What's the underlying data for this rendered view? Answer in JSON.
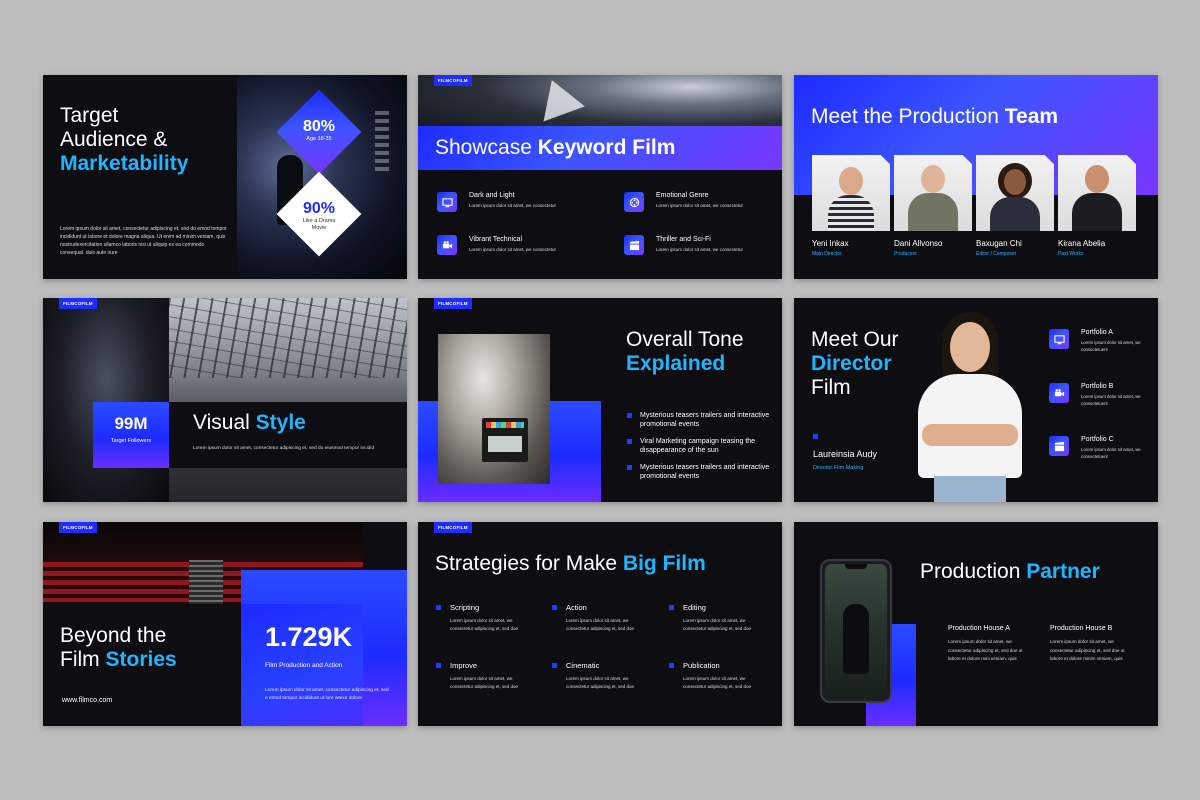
{
  "brand_tag": "FILMCOFILM",
  "s1": {
    "title_line1": "Target",
    "title_line2": "Audience &",
    "title_line3": "Marketability",
    "body": "Lorem ipsum dolor sit amet, consectetur adipiscing et, sed do emod tempor incididunt ut labore et dolore magna aliqua. Ut enim ad minim veniam, quis nostrudexercitation ullamco laboris nisi ut aliquip ex ea commodo consequat. duis aute irure",
    "stat1_value": "80%",
    "stat1_label": "Age 18-35",
    "stat2_value": "90%",
    "stat2_label": "Like a Drama Movie"
  },
  "s2": {
    "title_a": "Showcase ",
    "title_b": "Keyword Film",
    "items": [
      {
        "title": "Dark and Light",
        "desc": "Lorem ipsum dolor sit amet, we consectetur",
        "icon": "monitor-icon"
      },
      {
        "title": "Emotional Genre",
        "desc": "Lorem ipsum dolor sit amet, we consectetur",
        "icon": "film-reel-icon"
      },
      {
        "title": "Vibrant Technical",
        "desc": "Lorem ipsum dolor sit amet, we consectetur",
        "icon": "video-camera-icon"
      },
      {
        "title": "Thriller and Sci-Fi",
        "desc": "Lorem ipsum dolor sit amet, we consectetur",
        "icon": "clapperboard-icon"
      }
    ]
  },
  "s3": {
    "title_a": "Meet the Production ",
    "title_b": "Team",
    "members": [
      {
        "name": "Yeni Inkax",
        "role": "Main Director"
      },
      {
        "name": "Dani Allvonso",
        "role": "Producers"
      },
      {
        "name": "Baxugan Chi",
        "role": "Editor / Composer"
      },
      {
        "name": "Kirana Abelia",
        "role": "Past Works"
      }
    ]
  },
  "s4": {
    "stat_value": "99M",
    "stat_label": "Target Followers",
    "title_a": "Visual ",
    "title_b": "Style",
    "body": "Lorem ipsum dolor sit amet, consectetur adipiscing et, sed do eiusmod tempor incidid"
  },
  "s5": {
    "title_line1": "Overall Tone",
    "title_line2": "Explained",
    "bullets": [
      "Mysterious teasers trailers and interactive promotional events",
      "Viral Marketing campaign teasing the disappearance of the sun",
      "Mysterious teasers trailers and interactive promotional events"
    ]
  },
  "s6": {
    "title_line1": "Meet Our",
    "title_line2": "Director",
    "title_line3": "Film",
    "name": "Laureinsia Audy",
    "role": "Director Film Making",
    "portfolios": [
      {
        "title": "Portfolio A",
        "desc": "Lorem ipsum dolor sit amet, we consectetuerir",
        "icon": "monitor-icon"
      },
      {
        "title": "Portfolio B",
        "desc": "Lorem ipsum dolor sit amet, we consectetuerir",
        "icon": "video-camera-icon"
      },
      {
        "title": "Portfolio C",
        "desc": "Lorem ipsum dolor sit amet, we consectetuerir",
        "icon": "clapperboard-icon"
      }
    ]
  },
  "s7": {
    "title_line1": "Beyond the",
    "title_a": "Film ",
    "title_b": "Stories",
    "website": "www.filmco.com",
    "stat_value": "1.729K",
    "stat_label": "Film Production and Action",
    "body": "Lorem ipsum dolor sit amet, consectetur adipiscing et, sed e emod tempor incididunt ut lore wtexe dolore"
  },
  "s8": {
    "title_a": "Strategies for Make ",
    "title_b": "Big Film",
    "items": [
      {
        "title": "Scripting",
        "desc": "Lorem ipsum dolor sit amet, we consectetur adipiscing et, sed doe"
      },
      {
        "title": "Action",
        "desc": "Lorem ipsum dolor sit amet, we consectetur adipiscing et, sed doe"
      },
      {
        "title": "Editing",
        "desc": "Lorem ipsum dolor sit amet, we consectetur adipiscing et, sed doe"
      },
      {
        "title": "Improve",
        "desc": "Lorem ipsum dolor sit amet, we consectetur adipiscing et, sed doe"
      },
      {
        "title": "Cinematic",
        "desc": "Lorem ipsum dolor sit amet, we consectetur adipiscing et, sed doe"
      },
      {
        "title": "Publication",
        "desc": "Lorem ipsum dolor sit amet, we consectetur adipiscing et, sed doe"
      }
    ]
  },
  "s9": {
    "title_a": "Production ",
    "title_b": "Partner",
    "partners": [
      {
        "title": "Production House A",
        "desc": "Lorem ipsum dolor sit amet, we consectetur adipiscing et, sed doe ut labore et dolore mini veniam, quis"
      },
      {
        "title": "Production House B",
        "desc": "Lorem ipsum dolor sit amet, we consectetur adipiscing et, sed doe ut labore et dolore minim veniam, quis"
      }
    ]
  },
  "colors": {
    "accent_blue": "#1fb5ff",
    "brand_blue": "#1f2bff",
    "slide_bg": "#0e0e12",
    "page_bg": "#bdbdbd"
  }
}
